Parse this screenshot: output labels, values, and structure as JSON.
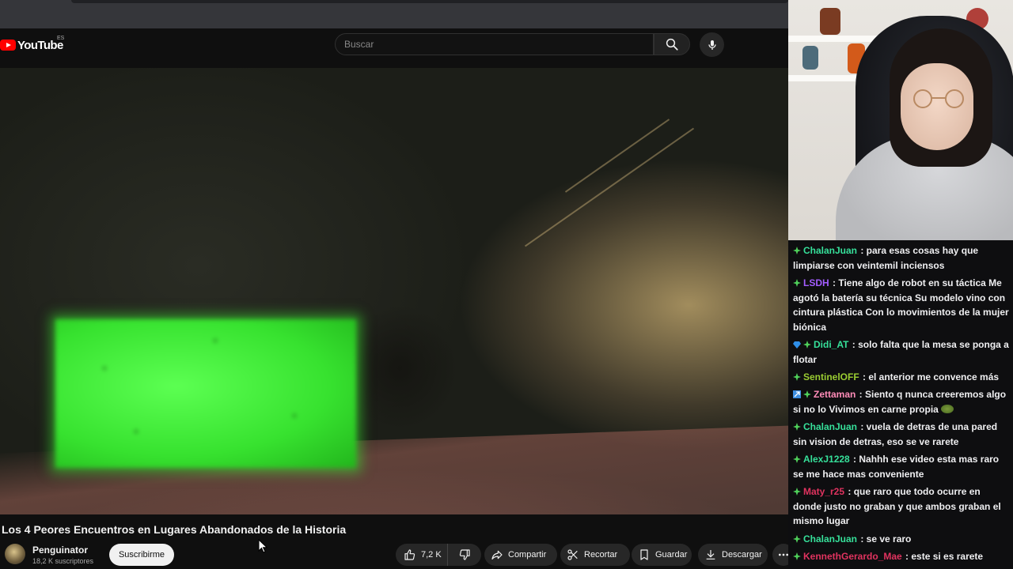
{
  "youtube": {
    "logo_text": "YouTube",
    "region": "ES",
    "search_placeholder": "Buscar"
  },
  "video": {
    "title": "Los 4 Peores Encuentros en Lugares Abandonados de la Historia",
    "channel": "Penguinator",
    "subscribers": "18,2 K suscriptores",
    "subscribe_label": "Suscribirme",
    "likes": "7,2 K",
    "share_label": "Compartir",
    "clip_label": "Recortar",
    "save_label": "Guardar",
    "download_label": "Descargar"
  },
  "chat": {
    "messages": [
      {
        "user": "ChalanJuan",
        "color": "#36e09a",
        "text": ": para esas cosas hay que limpiarse con veintemil inciensos",
        "badges": [
          "plus"
        ]
      },
      {
        "user": "LSDH",
        "color": "#a35dff",
        "text": ": Tiene algo de robot en su táctica Me agotó la batería su técnica Su modelo vino con cintura plástica Con lo movimientos de la mujer biónica",
        "badges": [
          "plus"
        ]
      },
      {
        "user": "Didi_AT",
        "color": "#36e09a",
        "text": ": solo falta que la mesa se ponga a flotar",
        "badges": [
          "gem",
          "plus"
        ]
      },
      {
        "user": "SentinelOFF",
        "color": "#9acd32",
        "text": ": el anterior me convence más",
        "badges": [
          "plus"
        ]
      },
      {
        "user": "Zettaman",
        "color": "#ff8cb8",
        "text": ": Siento q nunca creeremos algo si no lo Vivimos en carne propia",
        "badges": [
          "prime",
          "plus"
        ],
        "emote": true
      },
      {
        "user": "ChalanJuan",
        "color": "#36e09a",
        "text": ": vuela de detras de una pared sin vision de detras, eso se ve rarete",
        "badges": [
          "plus"
        ]
      },
      {
        "user": "AlexJ1228",
        "color": "#36e09a",
        "text": ": Nahhh ese video esta mas raro se me hace mas conveniente",
        "badges": [
          "plus"
        ]
      },
      {
        "user": "Maty_r25",
        "color": "#e0335f",
        "text": ": que raro que todo ocurre en donde justo no graban y que ambos graban el mismo lugar",
        "badges": [
          "plus"
        ]
      },
      {
        "user": "ChalanJuan",
        "color": "#36e09a",
        "text": ": se ve raro",
        "badges": [
          "plus"
        ]
      },
      {
        "user": "KennethGerardo_Mae",
        "color": "#e0335f",
        "text": ": este si es rarete",
        "badges": [
          "plus"
        ]
      }
    ]
  }
}
